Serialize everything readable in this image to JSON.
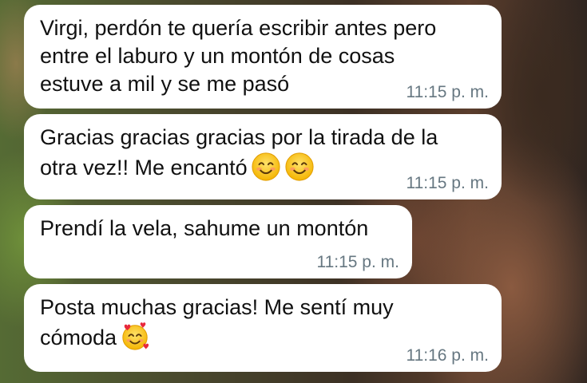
{
  "messages": [
    {
      "text": "Virgi, perdón te quería escribir antes pero\nentre el laburo y un montón de cosas\nestuve a mil y se me pasó",
      "time": "11:15 p. m."
    },
    {
      "text": "Gracias gracias gracias por la tirada de la\notra vez!! Me encantó",
      "time": "11:15 p. m.",
      "emojis": [
        "smiling-face-with-smiling-eyes",
        "smiling-face-with-smiling-eyes"
      ]
    },
    {
      "text": "Prendí la vela, sahume un montón",
      "time": "11:15 p. m."
    },
    {
      "text": "Posta muchas gracias! Me sentí muy\ncómoda",
      "time": "11:16 p. m.",
      "emojis": [
        "smiling-face-with-hearts"
      ]
    }
  ],
  "colors": {
    "bubble": "#ffffff",
    "timestamp": "#667781",
    "text": "#111111"
  }
}
